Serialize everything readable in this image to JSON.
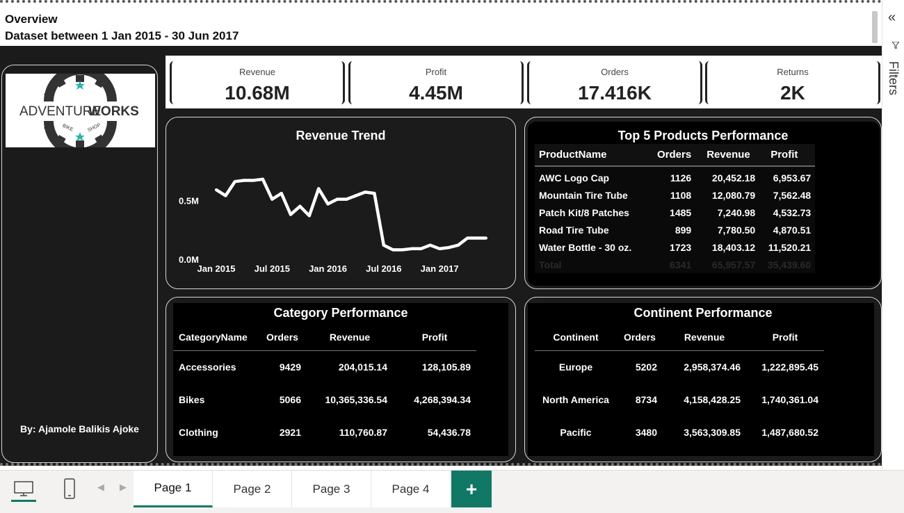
{
  "header": {
    "title": "Overview",
    "subtitle": "Dataset between 1 Jan 2015 - 30 Jun 2017"
  },
  "filters_pane": {
    "collapse_glyph": "«",
    "label": "Filters",
    "icon": "filter-icon"
  },
  "left_panel": {
    "logo_text_left": "ADVENTURE",
    "logo_text_right": "WORKS",
    "logo_tag_left": "BIKE",
    "logo_tag_right": "SHOP",
    "author": "By: Ajamole Balikis Ajoke"
  },
  "kpis": [
    {
      "label": "Revenue",
      "value": "10.68M"
    },
    {
      "label": "Profit",
      "value": "4.45M"
    },
    {
      "label": "Orders",
      "value": "17.416K"
    },
    {
      "label": "Returns",
      "value": "2K"
    }
  ],
  "chart_data": {
    "type": "line",
    "title": "Revenue Trend",
    "x_tick_labels": [
      "Jan 2015",
      "Jul 2015",
      "Jan 2016",
      "Jul 2016",
      "Jan 2017"
    ],
    "y_tick_labels": [
      "0.0M",
      "0.5M"
    ],
    "ylim": [
      0,
      0.85
    ],
    "x": [
      "2015-01",
      "2015-02",
      "2015-03",
      "2015-04",
      "2015-05",
      "2015-06",
      "2015-07",
      "2015-08",
      "2015-09",
      "2015-10",
      "2015-11",
      "2015-12",
      "2016-01",
      "2016-02",
      "2016-03",
      "2016-04",
      "2016-05",
      "2016-06",
      "2016-07",
      "2016-08",
      "2016-09",
      "2016-10",
      "2016-11",
      "2016-12",
      "2017-01",
      "2017-02",
      "2017-03",
      "2017-04",
      "2017-05",
      "2017-06"
    ],
    "values": [
      0.59,
      0.54,
      0.66,
      0.67,
      0.67,
      0.68,
      0.51,
      0.56,
      0.38,
      0.45,
      0.37,
      0.6,
      0.47,
      0.51,
      0.51,
      0.54,
      0.57,
      0.56,
      0.12,
      0.08,
      0.08,
      0.09,
      0.09,
      0.12,
      0.09,
      0.1,
      0.12,
      0.18,
      0.18,
      0.18
    ],
    "grid": false,
    "color": "#ffffff"
  },
  "top5": {
    "title": "Top 5 Products Performance",
    "columns": [
      "ProductName",
      "Orders",
      "Revenue",
      "Profit"
    ],
    "rows": [
      [
        "AWC Logo Cap",
        "1126",
        "20,452.18",
        "6,953.67"
      ],
      [
        "Mountain Tire Tube",
        "1108",
        "12,080.79",
        "7,562.48"
      ],
      [
        "Patch Kit/8 Patches",
        "1485",
        "7,240.98",
        "4,532.73"
      ],
      [
        "Road Tire Tube",
        "899",
        "7,780.50",
        "4,870.51"
      ],
      [
        "Water Bottle - 30 oz.",
        "1723",
        "18,403.12",
        "11,520.21"
      ]
    ],
    "total": [
      "Total",
      "6341",
      "65,957.57",
      "35,439.60"
    ]
  },
  "category": {
    "title": "Category Performance",
    "columns": [
      "CategoryName",
      "Orders",
      "Revenue",
      "Profit"
    ],
    "rows": [
      [
        "Accessories",
        "9429",
        "204,015.14",
        "128,105.89"
      ],
      [
        "Bikes",
        "5066",
        "10,365,336.54",
        "4,268,394.34"
      ],
      [
        "Clothing",
        "2921",
        "110,760.87",
        "54,436.78"
      ]
    ]
  },
  "continent": {
    "title": "Continent Performance",
    "columns": [
      "Continent",
      "Orders",
      "Revenue",
      "Profit"
    ],
    "rows": [
      [
        "Europe",
        "5202",
        "2,958,374.46",
        "1,222,895.45"
      ],
      [
        "North America",
        "8734",
        "4,158,428.25",
        "1,740,361.04"
      ],
      [
        "Pacific",
        "3480",
        "3,563,309.85",
        "1,487,680.52"
      ]
    ]
  },
  "tabbar": {
    "tabs": [
      "Page 1",
      "Page 2",
      "Page 3",
      "Page 4"
    ],
    "active_tab": "Page 1",
    "add_label": "+",
    "prev_arrow": "◀",
    "next_arrow": "▶"
  },
  "colors": {
    "accent": "#117865",
    "canvas": "#1b1b1b",
    "logo_star": "#2bb3b0"
  }
}
